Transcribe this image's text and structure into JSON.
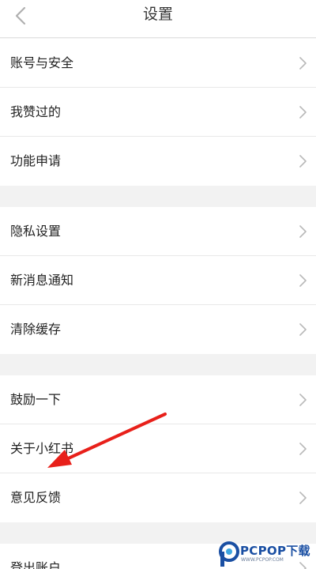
{
  "header": {
    "title": "设置",
    "back_icon": "chevron-left-icon"
  },
  "settings": {
    "group1": [
      {
        "label": "账号与安全"
      },
      {
        "label": "我赞过的"
      },
      {
        "label": "功能申请"
      }
    ],
    "group2": [
      {
        "label": "隐私设置"
      },
      {
        "label": "新消息通知"
      },
      {
        "label": "清除缓存"
      }
    ],
    "group3": [
      {
        "label": "鼓励一下"
      },
      {
        "label": "关于小红书"
      },
      {
        "label": "意见反馈"
      }
    ],
    "group4": [
      {
        "label": "登出账户"
      }
    ]
  },
  "overlay": {
    "arrow_color": "#e8201a"
  },
  "watermark": {
    "text": "PCPOP下载",
    "subtext": "WWW.PCPOP.COM"
  },
  "colors": {
    "background": "#f2f2f2",
    "row": "#ffffff",
    "chevron": "#b8b8b8",
    "watermark_blue": "#1a4fa3"
  }
}
